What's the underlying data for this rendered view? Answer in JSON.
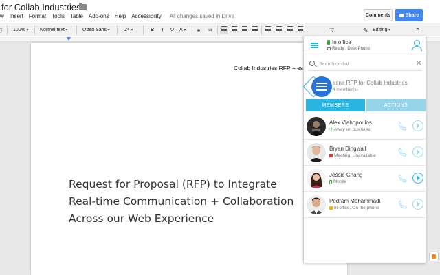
{
  "doc": {
    "title": "for Collab Industries",
    "save_status": "All changes saved in Drive",
    "header_text": "Collab Industries RFP + esna",
    "heading_lines": [
      "Request for Proposal (RFP) to Integrate",
      "Real-time Communication + Collaboration",
      "Across our Web Experience"
    ]
  },
  "menu": [
    "w",
    "Insert",
    "Format",
    "Tools",
    "Table",
    "Add-ons",
    "Help",
    "Accessibility"
  ],
  "header_buttons": {
    "comments": "Comments",
    "share": "Share"
  },
  "toolbar": {
    "zoom": "100%",
    "style": "Normal text",
    "font": "Open Sans",
    "size": "24",
    "bold": "B",
    "italic": "I",
    "underline": "U",
    "text_color": "A",
    "mode": "Editing"
  },
  "panel": {
    "presence": "In office",
    "device": "Ready : Desk Phone",
    "search_placeholder": "Search or dial",
    "group_name": "esna RFP for Collab Industries",
    "group_members": "4 member(s)",
    "tabs": {
      "members": "MEMBERS",
      "actions": "ACTIONS"
    },
    "contacts": [
      {
        "name": "Alex Vlahopoulos",
        "status": "Away on business",
        "status_color": "#3aaa35"
      },
      {
        "name": "Bryan Dingwall",
        "status": "Meeting, Unavailable",
        "status_color": "#e23c3c"
      },
      {
        "name": "Jessie Chang",
        "status": "Mobile",
        "status_color": "#3aaa35"
      },
      {
        "name": "Pedram Mohammadi",
        "status": "In office, On the phone",
        "status_color": "#f0b400"
      }
    ]
  },
  "colors": {
    "accent": "#29b6e0",
    "share": "#4285f4",
    "available": "#3aaa35"
  }
}
